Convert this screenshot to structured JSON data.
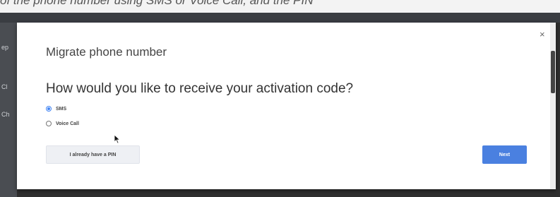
{
  "background": {
    "top_text": "of the phone number using SMS or Voice Call, and the PIN",
    "side_labels": [
      "ep",
      "Cl",
      "Ch"
    ]
  },
  "dialog": {
    "close_label": "×",
    "title": "Migrate phone number",
    "question": "How would you like to receive your activation code?",
    "options": [
      {
        "label": "SMS",
        "selected": true
      },
      {
        "label": "Voice Call",
        "selected": false
      }
    ],
    "secondary_button": "I already have a PIN",
    "primary_button": "Next"
  },
  "colors": {
    "accent": "#4285f4",
    "primary_button_bg": "#4a80e0",
    "secondary_button_bg": "#eef0f4",
    "overlay": "#2f2f2f"
  }
}
